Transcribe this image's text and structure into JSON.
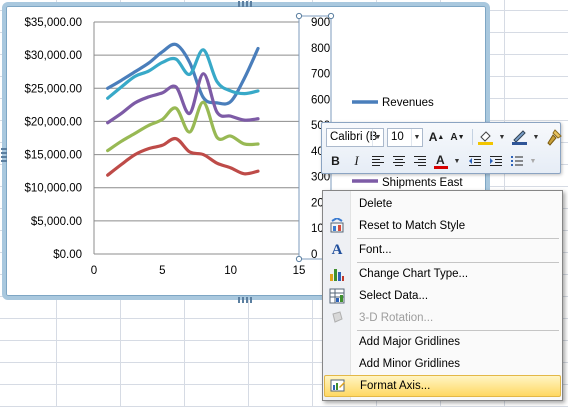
{
  "chart_data": {
    "type": "line",
    "x": [
      1,
      2,
      3,
      4,
      5,
      6,
      7,
      8,
      9,
      10,
      11,
      12
    ],
    "xlim": [
      0,
      15
    ],
    "xticks": [
      "0",
      "5",
      "10",
      "15"
    ],
    "ylim": [
      0,
      35000
    ],
    "yticks": [
      "$0.00",
      "$5,000.00",
      "$10,000.00",
      "$15,000.00",
      "$20,000.00",
      "$25,000.00",
      "$30,000.00",
      "$35,000.00"
    ],
    "y2lim": [
      0,
      900
    ],
    "y2ticks": [
      "0",
      "100",
      "200",
      "300",
      "400",
      "500",
      "600",
      "700",
      "800",
      "900"
    ],
    "grid": true,
    "legend_position": "right",
    "series": [
      {
        "name": "Revenues",
        "color": "#4a7ebb",
        "values": [
          25000,
          26200,
          27500,
          28800,
          30500,
          31600,
          28900,
          23600,
          22800,
          23000,
          26500,
          31000
        ]
      },
      {
        "name": "",
        "color": "#38a9c8",
        "values": [
          23500,
          25200,
          26800,
          27600,
          28900,
          29400,
          27100,
          30800,
          26000,
          24600,
          24200,
          24600
        ]
      },
      {
        "name": "Shipments East",
        "color": "#7d5ba6",
        "values": [
          19800,
          21200,
          22800,
          23700,
          24300,
          25200,
          21200,
          27200,
          21400,
          20800,
          20200,
          20400
        ]
      },
      {
        "name": "",
        "color": "#98b954",
        "values": [
          15600,
          17000,
          18200,
          19400,
          20300,
          22000,
          18400,
          22900,
          17600,
          17800,
          16600,
          16600
        ]
      },
      {
        "name": "",
        "color": "#be4b48",
        "values": [
          11900,
          13500,
          15000,
          15900,
          16400,
          17400,
          15400,
          15000,
          13700,
          13000,
          12100,
          12500
        ]
      }
    ]
  },
  "legend": {
    "revenues": "Revenues",
    "shipments_east": "Shipments East"
  },
  "mini_toolbar": {
    "font_name": "Calibri (B",
    "font_size": "10",
    "icons": [
      "grow-font-icon",
      "shrink-font-icon",
      "fill-color-icon",
      "line-color-icon",
      "format-painter-icon",
      "bold-icon",
      "italic-icon",
      "align-left-icon",
      "center-icon",
      "align-right-icon",
      "font-color-icon",
      "decrease-indent-icon",
      "increase-indent-icon",
      "bullets-icon"
    ],
    "font_color": "#d80000",
    "fill_color": "#f2c500"
  },
  "context_menu": {
    "items": [
      {
        "label": "Delete",
        "icon": "",
        "disabled": false
      },
      {
        "label": "Reset to Match Style",
        "icon": "reset-style-icon",
        "disabled": false
      },
      {
        "label": "Font...",
        "icon": "font-icon",
        "disabled": false
      },
      {
        "label": "Change Chart Type...",
        "icon": "chart-type-icon",
        "disabled": false
      },
      {
        "label": "Select Data...",
        "icon": "select-data-icon",
        "disabled": false
      },
      {
        "label": "3-D Rotation...",
        "icon": "rotation-icon",
        "disabled": true
      },
      {
        "label": "Add Major Gridlines",
        "icon": "",
        "disabled": false
      },
      {
        "label": "Add Minor Gridlines",
        "icon": "",
        "disabled": false
      },
      {
        "label": "Format Axis...",
        "icon": "format-axis-icon",
        "disabled": false,
        "highlighted": true
      }
    ]
  }
}
